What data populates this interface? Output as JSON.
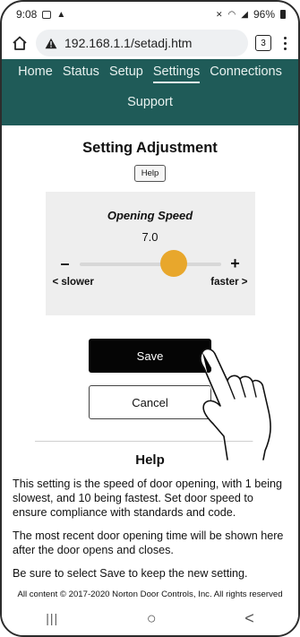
{
  "status_bar": {
    "time": "9:08",
    "battery": "96%"
  },
  "browser": {
    "url": "192.168.1.1/setadj.htm",
    "tab_count": "3"
  },
  "nav": {
    "items": [
      "Home",
      "Status",
      "Setup",
      "Settings",
      "Connections"
    ],
    "second_row": "Support",
    "active": "Settings"
  },
  "page": {
    "title": "Setting Adjustment",
    "help_button": "Help",
    "setting": {
      "label": "Opening Speed",
      "value": "7.0",
      "min": 1,
      "max": 10,
      "current": 7.0,
      "minus": "–",
      "plus": "+",
      "slower_label": "< slower",
      "faster_label": "faster >"
    },
    "save_label": "Save",
    "cancel_label": "Cancel",
    "help_heading": "Help",
    "help_paragraphs": [
      "This setting is the speed of door opening, with 1 being slowest, and 10 being fastest. Set door speed to ensure compliance with standards and code.",
      "The most recent door opening time will be shown here after the door opens and closes.",
      "Be sure to select Save to keep the new setting."
    ],
    "copyright": "All content © 2017-2020 Norton Door Controls, Inc. All rights reserved"
  },
  "android_nav": {
    "recents": "|||",
    "home": "○",
    "back": "<"
  },
  "colors": {
    "nav_bg": "#1f5b58",
    "thumb": "#e8a72c",
    "save_bg": "#050505"
  }
}
